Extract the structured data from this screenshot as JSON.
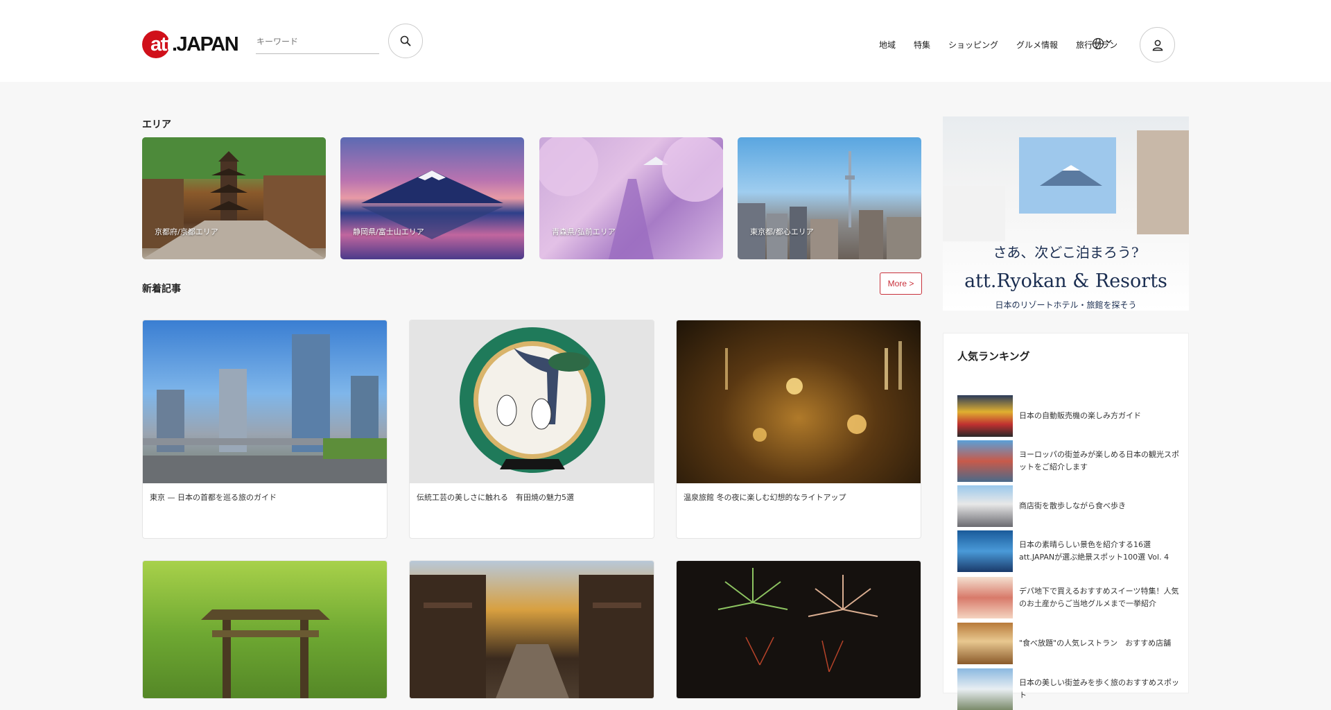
{
  "header": {
    "logo_text": "att.JAPAN",
    "search_placeholder": "キーワード",
    "nav": [
      "地域",
      "特集",
      "ショッピング",
      "グルメ情報",
      "旅行プラン"
    ],
    "language_icon": "globe-icon",
    "user_icon": "user-icon"
  },
  "areas": {
    "title": "エリア",
    "cards": [
      {
        "label": "京都府/京都エリア"
      },
      {
        "label": "静岡県/富士山エリア"
      },
      {
        "label": "青森県/弘前エリア"
      },
      {
        "label": "東京都/都心エリア"
      }
    ]
  },
  "articles": {
    "title": "新着記事",
    "more_label": "More >",
    "items": [
      {
        "title": "東京 — 日本の首都を巡る旅のガイド"
      },
      {
        "title": "伝統工芸の美しさに触れる　有田焼の魅力5選"
      },
      {
        "title": "温泉旅館 冬の夜に楽しむ幻想的なライトアップ"
      },
      {
        "title": ""
      },
      {
        "title": ""
      },
      {
        "title": ""
      }
    ]
  },
  "ad": {
    "tagline": "さあ、次どこ泊まろう?",
    "brand": "att.Ryokan & Resorts",
    "subtitle": "日本のリゾートホテル・旅館を探そう"
  },
  "ranking": {
    "title": "人気ランキング",
    "items": [
      {
        "text": "日本の自動販売機の楽しみ方ガイド"
      },
      {
        "text": "ヨーロッパの街並みが楽しめる日本の観光スポットをご紹介します"
      },
      {
        "text": "商店街を散歩しながら食べ歩き"
      },
      {
        "text": "日本の素晴らしい景色を紹介する16選att.JAPANが選ぶ絶景スポット100選 Vol. 4"
      },
      {
        "text": "デパ地下で買えるおすすめスイーツ特集！人気のお土産からご当地グルメまで一挙紹介"
      },
      {
        "text": "\"食べ放題\"の人気レストラン　おすすめ店舗"
      },
      {
        "text": "日本の美しい街並みを歩く旅のおすすめスポット"
      }
    ]
  }
}
